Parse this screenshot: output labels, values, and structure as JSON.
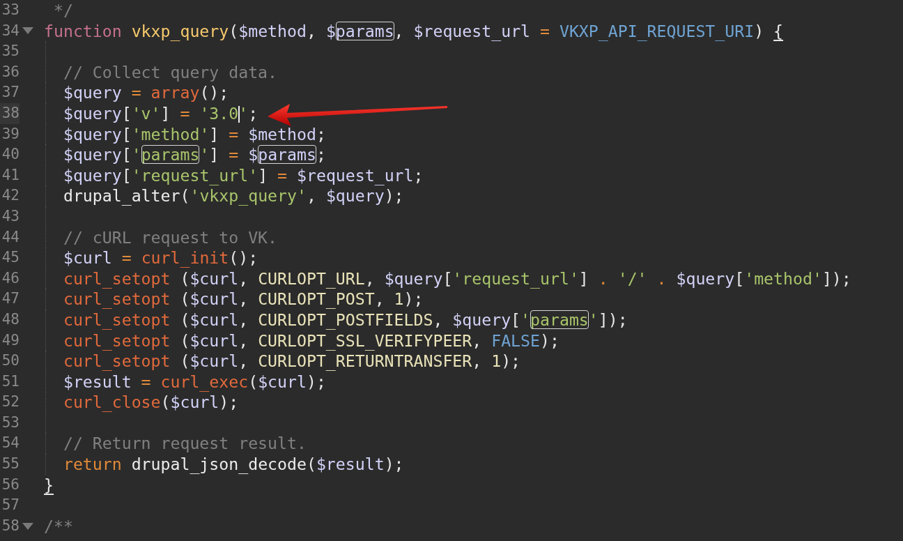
{
  "editor": {
    "lines": [
      {
        "number": "33",
        "fold": false,
        "current": false,
        "guide": false,
        "tokens": [
          {
            "kind": "cmt",
            "text": " */"
          }
        ]
      },
      {
        "number": "34",
        "fold": true,
        "current": false,
        "guide": false,
        "tokens": [
          {
            "kind": "kw",
            "text": "function"
          },
          {
            "kind": "fn",
            "text": " vkxp_query"
          },
          {
            "kind": "punc",
            "text": "("
          },
          {
            "kind": "var",
            "text": "$method"
          },
          {
            "kind": "punc",
            "text": ", "
          },
          {
            "kind": "var",
            "text": "$"
          },
          {
            "kind": "var",
            "text": "params",
            "boxed": true
          },
          {
            "kind": "punc",
            "text": ", "
          },
          {
            "kind": "var",
            "text": "$request_url"
          },
          {
            "kind": "op",
            "text": " = "
          },
          {
            "kind": "blue",
            "text": "VKXP_API_REQUEST_URI"
          },
          {
            "kind": "punc",
            "text": ") "
          },
          {
            "kind": "punc",
            "text": "{",
            "underlined": true
          }
        ]
      },
      {
        "number": "35",
        "fold": false,
        "current": false,
        "guide": true
      },
      {
        "number": "36",
        "fold": false,
        "current": false,
        "guide": true,
        "tokens": [
          {
            "kind": "cmt",
            "text": "  // Collect query data."
          }
        ]
      },
      {
        "number": "37",
        "fold": false,
        "current": false,
        "guide": true,
        "tokens": [
          {
            "kind": "var",
            "text": "  $query"
          },
          {
            "kind": "op",
            "text": " = "
          },
          {
            "kind": "call",
            "text": "array"
          },
          {
            "kind": "punc",
            "text": "();"
          }
        ]
      },
      {
        "number": "38",
        "fold": false,
        "current": true,
        "guide": true,
        "tokens": [
          {
            "kind": "var",
            "text": "  $query"
          },
          {
            "kind": "punc",
            "text": "["
          },
          {
            "kind": "str",
            "text": "'v'"
          },
          {
            "kind": "punc",
            "text": "]"
          },
          {
            "kind": "op",
            "text": " = "
          },
          {
            "kind": "str",
            "text": "'3.0"
          },
          {
            "kind": "cursor"
          },
          {
            "kind": "str",
            "text": "'"
          },
          {
            "kind": "punc",
            "text": ";"
          }
        ]
      },
      {
        "number": "39",
        "fold": false,
        "current": false,
        "guide": true,
        "tokens": [
          {
            "kind": "var",
            "text": "  $query"
          },
          {
            "kind": "punc",
            "text": "["
          },
          {
            "kind": "str",
            "text": "'method'"
          },
          {
            "kind": "punc",
            "text": "]"
          },
          {
            "kind": "op",
            "text": " = "
          },
          {
            "kind": "var",
            "text": "$method"
          },
          {
            "kind": "punc",
            "text": ";"
          }
        ]
      },
      {
        "number": "40",
        "fold": false,
        "current": false,
        "guide": true,
        "tokens": [
          {
            "kind": "var",
            "text": "  $query"
          },
          {
            "kind": "punc",
            "text": "["
          },
          {
            "kind": "str",
            "text": "'"
          },
          {
            "kind": "str",
            "text": "params",
            "boxed": true
          },
          {
            "kind": "str",
            "text": "'"
          },
          {
            "kind": "punc",
            "text": "]"
          },
          {
            "kind": "op",
            "text": " = "
          },
          {
            "kind": "var",
            "text": "$"
          },
          {
            "kind": "var",
            "text": "params",
            "boxed": true
          },
          {
            "kind": "punc",
            "text": ";"
          }
        ]
      },
      {
        "number": "41",
        "fold": false,
        "current": false,
        "guide": true,
        "tokens": [
          {
            "kind": "var",
            "text": "  $query"
          },
          {
            "kind": "punc",
            "text": "["
          },
          {
            "kind": "str",
            "text": "'request_url'"
          },
          {
            "kind": "punc",
            "text": "]"
          },
          {
            "kind": "op",
            "text": " = "
          },
          {
            "kind": "var",
            "text": "$request_url"
          },
          {
            "kind": "punc",
            "text": ";"
          }
        ]
      },
      {
        "number": "42",
        "fold": false,
        "current": false,
        "guide": true,
        "tokens": [
          {
            "kind": "plain",
            "text": "  drupal_alter"
          },
          {
            "kind": "punc",
            "text": "("
          },
          {
            "kind": "str",
            "text": "'vkxp_query'"
          },
          {
            "kind": "punc",
            "text": ", "
          },
          {
            "kind": "var",
            "text": "$query"
          },
          {
            "kind": "punc",
            "text": ");"
          }
        ]
      },
      {
        "number": "43",
        "fold": false,
        "current": false,
        "guide": true
      },
      {
        "number": "44",
        "fold": false,
        "current": false,
        "guide": true,
        "tokens": [
          {
            "kind": "cmt",
            "text": "  // cURL request to VK."
          }
        ]
      },
      {
        "number": "45",
        "fold": false,
        "current": false,
        "guide": true,
        "tokens": [
          {
            "kind": "var",
            "text": "  $curl"
          },
          {
            "kind": "op",
            "text": " = "
          },
          {
            "kind": "call",
            "text": "curl_init"
          },
          {
            "kind": "punc",
            "text": "();"
          }
        ]
      },
      {
        "number": "46",
        "fold": false,
        "current": false,
        "guide": true,
        "tokens": [
          {
            "kind": "call",
            "text": "  curl_setopt"
          },
          {
            "kind": "punc",
            "text": " ("
          },
          {
            "kind": "var",
            "text": "$curl"
          },
          {
            "kind": "punc",
            "text": ", "
          },
          {
            "kind": "const",
            "text": "CURLOPT_URL"
          },
          {
            "kind": "punc",
            "text": ", "
          },
          {
            "kind": "var",
            "text": "$query"
          },
          {
            "kind": "punc",
            "text": "["
          },
          {
            "kind": "str",
            "text": "'request_url'"
          },
          {
            "kind": "punc",
            "text": "] "
          },
          {
            "kind": "op",
            "text": ". "
          },
          {
            "kind": "str",
            "text": "'/'"
          },
          {
            "kind": "op",
            "text": " . "
          },
          {
            "kind": "var",
            "text": "$query"
          },
          {
            "kind": "punc",
            "text": "["
          },
          {
            "kind": "str",
            "text": "'method'"
          },
          {
            "kind": "punc",
            "text": "]);"
          }
        ]
      },
      {
        "number": "47",
        "fold": false,
        "current": false,
        "guide": true,
        "tokens": [
          {
            "kind": "call",
            "text": "  curl_setopt"
          },
          {
            "kind": "punc",
            "text": " ("
          },
          {
            "kind": "var",
            "text": "$curl"
          },
          {
            "kind": "punc",
            "text": ", "
          },
          {
            "kind": "const",
            "text": "CURLOPT_POST"
          },
          {
            "kind": "punc",
            "text": ", "
          },
          {
            "kind": "num",
            "text": "1"
          },
          {
            "kind": "punc",
            "text": ");"
          }
        ]
      },
      {
        "number": "48",
        "fold": false,
        "current": false,
        "guide": true,
        "tokens": [
          {
            "kind": "call",
            "text": "  curl_setopt"
          },
          {
            "kind": "punc",
            "text": " ("
          },
          {
            "kind": "var",
            "text": "$curl"
          },
          {
            "kind": "punc",
            "text": ", "
          },
          {
            "kind": "const",
            "text": "CURLOPT_POSTFIELDS"
          },
          {
            "kind": "punc",
            "text": ", "
          },
          {
            "kind": "var",
            "text": "$query"
          },
          {
            "kind": "punc",
            "text": "["
          },
          {
            "kind": "str",
            "text": "'"
          },
          {
            "kind": "str",
            "text": "params",
            "boxed": true
          },
          {
            "kind": "str",
            "text": "'"
          },
          {
            "kind": "punc",
            "text": "]);"
          }
        ]
      },
      {
        "number": "49",
        "fold": false,
        "current": false,
        "guide": true,
        "tokens": [
          {
            "kind": "call",
            "text": "  curl_setopt"
          },
          {
            "kind": "punc",
            "text": " ("
          },
          {
            "kind": "var",
            "text": "$curl"
          },
          {
            "kind": "punc",
            "text": ", "
          },
          {
            "kind": "const",
            "text": "CURLOPT_SSL_VERIFYPEER"
          },
          {
            "kind": "punc",
            "text": ", "
          },
          {
            "kind": "blue",
            "text": "FALSE"
          },
          {
            "kind": "punc",
            "text": ");"
          }
        ]
      },
      {
        "number": "50",
        "fold": false,
        "current": false,
        "guide": true,
        "tokens": [
          {
            "kind": "call",
            "text": "  curl_setopt"
          },
          {
            "kind": "punc",
            "text": " ("
          },
          {
            "kind": "var",
            "text": "$curl"
          },
          {
            "kind": "punc",
            "text": ", "
          },
          {
            "kind": "const",
            "text": "CURLOPT_RETURNTRANSFER"
          },
          {
            "kind": "punc",
            "text": ", "
          },
          {
            "kind": "num",
            "text": "1"
          },
          {
            "kind": "punc",
            "text": ");"
          }
        ]
      },
      {
        "number": "51",
        "fold": false,
        "current": false,
        "guide": true,
        "tokens": [
          {
            "kind": "var",
            "text": "  $result"
          },
          {
            "kind": "op",
            "text": " = "
          },
          {
            "kind": "call",
            "text": "curl_exec"
          },
          {
            "kind": "punc",
            "text": "("
          },
          {
            "kind": "var",
            "text": "$curl"
          },
          {
            "kind": "punc",
            "text": ");"
          }
        ]
      },
      {
        "number": "52",
        "fold": false,
        "current": false,
        "guide": true,
        "tokens": [
          {
            "kind": "call",
            "text": "  curl_close"
          },
          {
            "kind": "punc",
            "text": "("
          },
          {
            "kind": "var",
            "text": "$curl"
          },
          {
            "kind": "punc",
            "text": ");"
          }
        ]
      },
      {
        "number": "53",
        "fold": false,
        "current": false,
        "guide": true
      },
      {
        "number": "54",
        "fold": false,
        "current": false,
        "guide": true,
        "tokens": [
          {
            "kind": "cmt",
            "text": "  // Return request result."
          }
        ]
      },
      {
        "number": "55",
        "fold": false,
        "current": false,
        "guide": true,
        "tokens": [
          {
            "kind": "kw2",
            "text": "  return"
          },
          {
            "kind": "plain",
            "text": " drupal_json_decode"
          },
          {
            "kind": "punc",
            "text": "("
          },
          {
            "kind": "var",
            "text": "$result"
          },
          {
            "kind": "punc",
            "text": ");"
          }
        ]
      },
      {
        "number": "56",
        "fold": false,
        "current": false,
        "guide": false,
        "tokens": [
          {
            "kind": "punc",
            "text": "}",
            "underlined": true
          }
        ]
      },
      {
        "number": "57",
        "fold": false,
        "current": false,
        "guide": false
      },
      {
        "number": "58",
        "fold": true,
        "current": false,
        "guide": false,
        "tokens": [
          {
            "kind": "cmt",
            "text": "/**"
          }
        ]
      }
    ]
  }
}
